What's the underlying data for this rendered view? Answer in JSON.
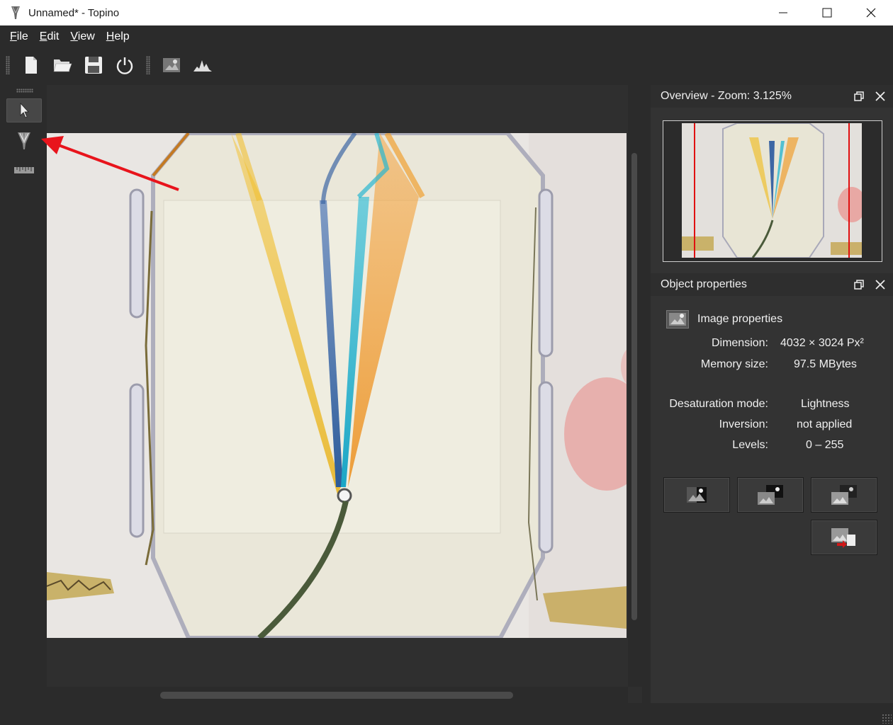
{
  "window": {
    "title": "Unnamed* - Topino",
    "app_icon": "topino-icon",
    "controls": [
      "minimize",
      "maximize",
      "close"
    ]
  },
  "menu": {
    "items": [
      {
        "label": "File",
        "mnemonic": "F",
        "rest": "ile"
      },
      {
        "label": "Edit",
        "mnemonic": "E",
        "rest": "dit"
      },
      {
        "label": "View",
        "mnemonic": "V",
        "rest": "iew"
      },
      {
        "label": "Help",
        "mnemonic": "H",
        "rest": "elp"
      }
    ]
  },
  "toolbar": {
    "buttons": [
      "new-file-icon",
      "open-folder-icon",
      "save-icon",
      "power-icon",
      "image-properties-icon",
      "histogram-icon"
    ]
  },
  "tools": {
    "items": [
      "select-pointer-icon",
      "inlet-marker-icon",
      "ruler-icon"
    ],
    "active": "select-pointer-icon"
  },
  "overview": {
    "title": "Overview - Zoom: 3.125%",
    "zoom_percent": 3.125
  },
  "object_properties": {
    "title": "Object properties",
    "section": "Image properties",
    "dimension_label": "Dimension:",
    "dimension_value": "4032 × 3024 Px²",
    "memory_label": "Memory size:",
    "memory_value": "97.5 MBytes",
    "desaturation_label": "Desaturation mode:",
    "desaturation_value": "Lightness",
    "inversion_label": "Inversion:",
    "inversion_value": "not applied",
    "levels_label": "Levels:",
    "levels_value": "0 – 255",
    "buttons": [
      "desaturate-icon",
      "invert-icon",
      "levels-icon",
      "export-icon"
    ]
  },
  "colors": {
    "annotation_arrow": "#e8141c",
    "overview_marker": "#e01010"
  }
}
